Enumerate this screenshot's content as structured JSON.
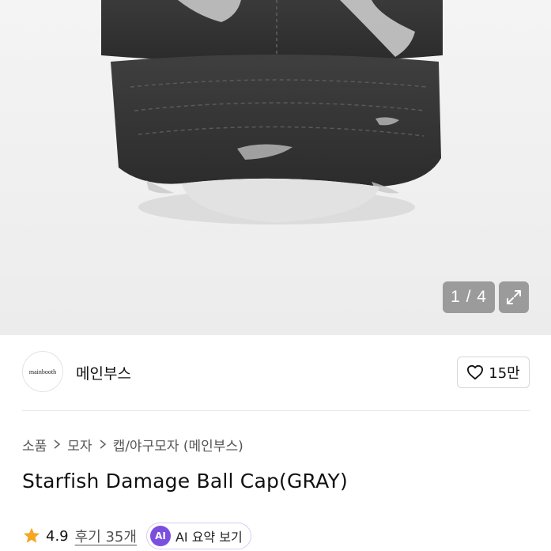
{
  "gallery": {
    "counter_text": "1 / 4",
    "current": 1,
    "total": 4,
    "expand_icon": "expand-icon"
  },
  "seller": {
    "logo_text": "mainbooth",
    "name": "메인부스",
    "like_count": "15만",
    "like_icon": "heart-icon"
  },
  "breadcrumb": {
    "items": [
      "소품",
      "모자",
      "캡/야구모자 (메인부스)"
    ],
    "separator_icon": "chevron-right-icon"
  },
  "product": {
    "title": "Starfish Damage Ball Cap(GRAY)"
  },
  "rating": {
    "value": "4.9",
    "reviews_label": "후기 35개",
    "star_icon": "star-icon",
    "star_color": "#f5a623"
  },
  "ai_summary": {
    "badge": "AI",
    "label": "AI 요약 보기",
    "badge_color": "#7a4fe0"
  }
}
